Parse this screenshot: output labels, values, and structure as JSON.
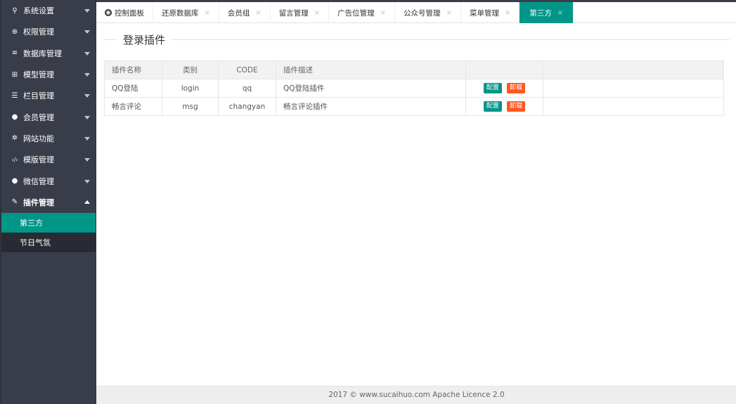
{
  "sidebar": {
    "items": [
      {
        "label": "系统设置",
        "icon": "key-icon",
        "glyph": "⚲"
      },
      {
        "label": "权限管理",
        "icon": "crosshair-icon",
        "glyph": "⊕"
      },
      {
        "label": "数据库管理",
        "icon": "database-icon",
        "glyph": "≡"
      },
      {
        "label": "模型管理",
        "icon": "model-icon",
        "glyph": "⊞"
      },
      {
        "label": "栏目管理",
        "icon": "list-icon",
        "glyph": "☰"
      },
      {
        "label": "会员管理",
        "icon": "user-icon",
        "glyph": "●"
      },
      {
        "label": "网站功能",
        "icon": "gear-icon",
        "glyph": "✲"
      },
      {
        "label": "模版管理",
        "icon": "code-icon",
        "glyph": "‹/›"
      },
      {
        "label": "微信管理",
        "icon": "chat-icon",
        "glyph": "●"
      },
      {
        "label": "插件管理",
        "icon": "plug-icon",
        "glyph": "✎"
      }
    ],
    "subitems": [
      {
        "label": "第三方"
      },
      {
        "label": "节日气氛"
      }
    ]
  },
  "tabs": [
    {
      "label": "控制面板"
    },
    {
      "label": "还原数据库"
    },
    {
      "label": "会员组"
    },
    {
      "label": "留言管理"
    },
    {
      "label": "广告位管理"
    },
    {
      "label": "公众号管理"
    },
    {
      "label": "菜单管理"
    },
    {
      "label": "第三方"
    }
  ],
  "close_glyph": "×",
  "page": {
    "title": "登录插件"
  },
  "table": {
    "headers": [
      "插件名称",
      "类别",
      "CODE",
      "插件描述",
      "",
      ""
    ],
    "rows": [
      {
        "name": "QQ登陆",
        "type": "login",
        "code": "qq",
        "desc": "QQ登陆插件"
      },
      {
        "name": "畅言评论",
        "type": "msg",
        "code": "changyan",
        "desc": "畅言评论插件"
      }
    ],
    "config_label": "配置",
    "uninstall_label": "卸载"
  },
  "footer": {
    "text": "2017 ©  www.sucaihuo.com  Apache Licence 2.0"
  },
  "colors": {
    "accent": "#009688",
    "danger": "#ff5722",
    "sidebar": "#393d49"
  }
}
